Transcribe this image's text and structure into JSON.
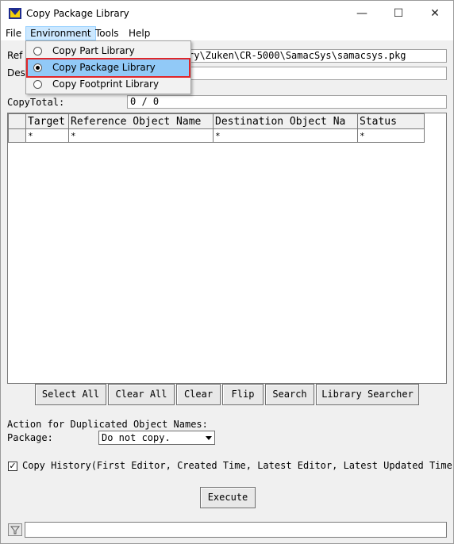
{
  "window": {
    "title": "Copy Package Library",
    "minimize_glyph": "—",
    "maximize_glyph": "☐",
    "close_glyph": "✕"
  },
  "menubar": {
    "items": [
      "File",
      "Environment",
      "Tools",
      "Help"
    ]
  },
  "environment_menu": {
    "items": [
      {
        "label": "Copy Part Library",
        "selected": false
      },
      {
        "label": "Copy Package Library",
        "selected": true
      },
      {
        "label": "Copy Footprint Library",
        "selected": false
      }
    ]
  },
  "form": {
    "ref_label": "Ref",
    "ref_value": "ry\\Zuken\\CR-5000\\SamacSys\\samacsys.pkg",
    "dest_label": "Des",
    "dest_value": "",
    "copy_total_label": "CopyTotal:",
    "copy_total_value": "0 / 0"
  },
  "table": {
    "columns": [
      "Target",
      "Reference Object Name",
      "Destination Object Na",
      "Status"
    ],
    "rows": [
      [
        "*",
        "*",
        "*",
        "*"
      ]
    ]
  },
  "buttons": {
    "select_all": "Select All",
    "clear_all": "Clear All",
    "clear": "Clear",
    "flip": "Flip",
    "search": "Search",
    "library_searcher": "Library Searcher",
    "execute": "Execute"
  },
  "options": {
    "duplicated_heading": "Action for Duplicated Object Names:",
    "package_label": "Package:",
    "package_value": "Do not copy.",
    "copy_history_label": "Copy History(First Editor, Created Time, Latest Editor, Latest Updated Time)",
    "copy_history_checked": true
  },
  "colors": {
    "menu_highlight": "#91c9f7",
    "highlight_outline": "#e0262a"
  }
}
